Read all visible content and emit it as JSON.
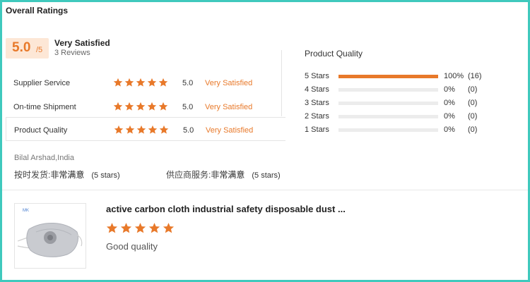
{
  "section_title": "Overall Ratings",
  "overall": {
    "score": "5.0",
    "denominator": "/5",
    "label": "Very Satisfied",
    "reviews": "3 Reviews"
  },
  "sub_ratings": [
    {
      "name": "Supplier Service",
      "value": "5.0",
      "text": "Very Satisfied",
      "stars": 5
    },
    {
      "name": "On-time Shipment",
      "value": "5.0",
      "text": "Very Satisfied",
      "stars": 5
    },
    {
      "name": "Product Quality",
      "value": "5.0",
      "text": "Very Satisfied",
      "stars": 5
    }
  ],
  "product_quality": {
    "title": "Product Quality",
    "rows": [
      {
        "label": "5 Stars",
        "fraction": 1.0,
        "pct": "100%",
        "count": "(16)"
      },
      {
        "label": "4 Stars",
        "fraction": 0,
        "pct": "0%",
        "count": "(0)"
      },
      {
        "label": "3 Stars",
        "fraction": 0,
        "pct": "0%",
        "count": "(0)"
      },
      {
        "label": "2 Stars",
        "fraction": 0,
        "pct": "0%",
        "count": "(0)"
      },
      {
        "label": "1 Stars",
        "fraction": 0,
        "pct": "0%",
        "count": "(0)"
      }
    ]
  },
  "review": {
    "reviewer": "Bilal Arshad,India",
    "attributes": [
      {
        "key": "按时发货:",
        "value": "非常满意",
        "stars": "(5 stars)"
      },
      {
        "key": "供应商服务:",
        "value": "非常满意",
        "stars": "(5 stars)"
      }
    ],
    "product_title": "active carbon cloth industrial safety disposable dust ...",
    "stars": 5,
    "text": "Good quality",
    "thumb_logo": "MK"
  },
  "colors": {
    "accent": "#e8792a",
    "score_bg": "#fde7d6",
    "frame": "#3fc9bd"
  }
}
